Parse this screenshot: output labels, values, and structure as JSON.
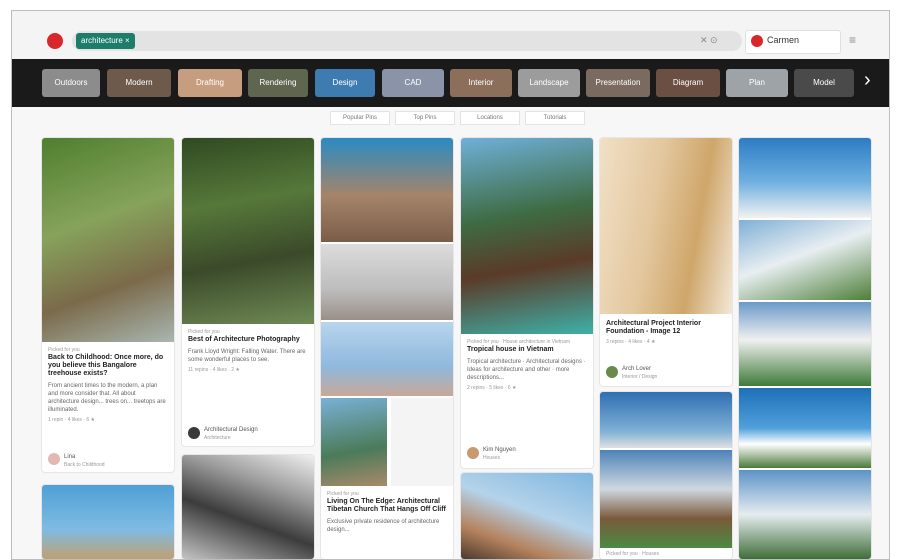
{
  "search": {
    "token": "architecture ×",
    "icons": "✕ ⊙"
  },
  "user": {
    "name": "Carmen"
  },
  "guides": [
    "Outdoors",
    "Modern",
    "Drafting",
    "Rendering",
    "Design",
    "CAD",
    "Interior",
    "Landscape",
    "Presentation",
    "Diagram",
    "Plan",
    "Model"
  ],
  "filters": [
    "Popular Pins",
    "Top Pins",
    "Locations",
    "Tutorials"
  ],
  "pins": {
    "c1": {
      "meta_small": "Picked for you",
      "title": "Back to Childhood: Once more, do you believe this Bangalore treehouse exists?",
      "desc": "From ancient times to the modern, a plan and more consider that. All about architecture design... trees on... treetops are illuminated.",
      "stats": "1 repin · 4 likes · 6 ★",
      "foot1": "Lina",
      "foot2": "Back to Childhood",
      "meta_small2": ""
    },
    "c2": {
      "meta_small": "Picked for you",
      "title": "Best of Architecture Photography",
      "desc": "Frank Lloyd Wright: Falling Water. There are some wonderful places to see.",
      "stats": "11 repins · 4 likes · 2 ★",
      "foot1": "Architectural Design",
      "foot2": "Architecture"
    },
    "c3": {
      "meta_small": "Picked for you",
      "title": "Living On The Edge: Architectural Tibetan Church That Hangs Off Cliff",
      "desc": "Exclusive private residence of architecture design..."
    },
    "c4": {
      "meta_small": "Picked for you  ·  House architecture in Vietnam",
      "title": "Tropical house in Vietnam",
      "desc": "Tropical architecture · Architectural designs · Ideas for architecture and other · more descriptions...",
      "stats": "2 repins · 5 likes · 6 ★",
      "foot1": "Kim Nguyen",
      "foot2": "Houses"
    },
    "c5": {
      "title": "Architectural Project Interior Foundation - Image 12",
      "stats": "3 repins · 4 likes · 4 ★",
      "foot1": "Arch Lover",
      "foot2": "Interior / Design"
    },
    "c6": {
      "meta_small": "Picked for you  ·  Houses"
    }
  }
}
